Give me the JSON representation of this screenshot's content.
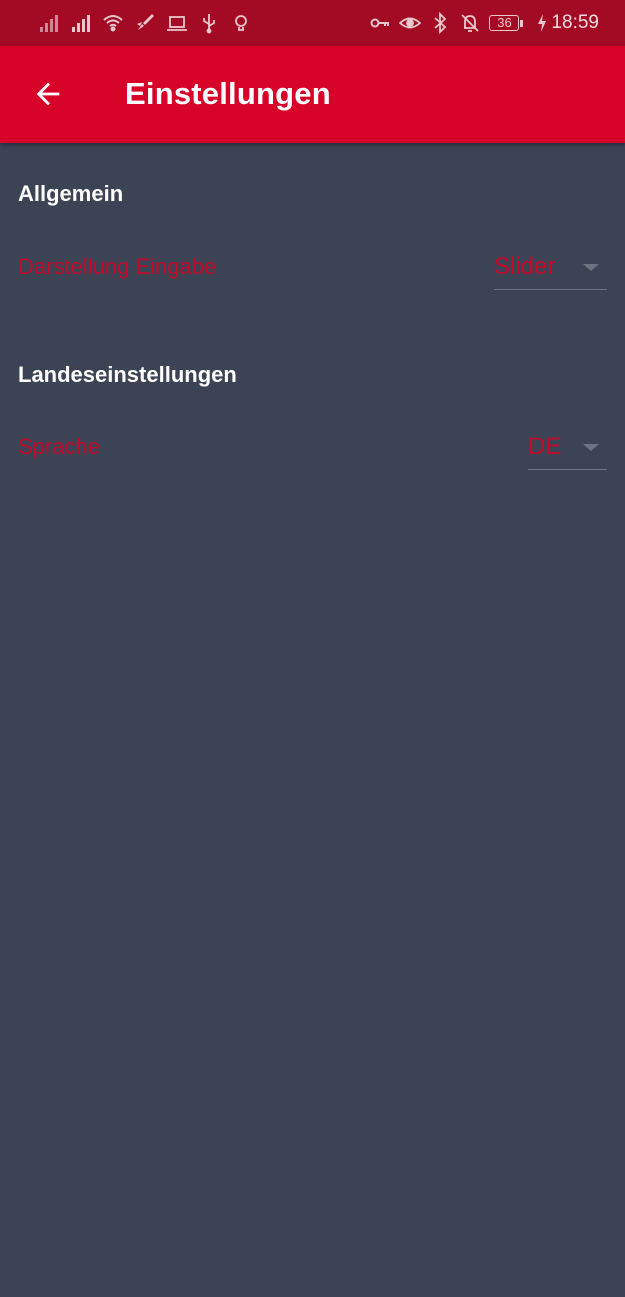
{
  "status_bar": {
    "time": "18:59",
    "battery_level": "36",
    "left_icons": [
      "signal-icon",
      "signal-icon",
      "wifi-icon",
      "rocket-icon",
      "laptop-icon",
      "usb-icon",
      "lightbulb-icon"
    ],
    "right_icons": [
      "key-icon",
      "eye-icon",
      "bluetooth-icon",
      "bell-off-icon",
      "battery-icon",
      "charging-icon"
    ]
  },
  "app_bar": {
    "title": "Einstellungen",
    "back_icon": "arrow-back-icon"
  },
  "sections": [
    {
      "title": "Allgemein",
      "preference": {
        "label": "Darstellung Eingabe",
        "value": "Slider"
      }
    },
    {
      "title": "Landeseinstellungen",
      "preference": {
        "label": "Sprache",
        "value": "DE"
      }
    }
  ],
  "colors": {
    "status_bar": "#a30b25",
    "app_bar": "#d80328",
    "background": "#3b4355",
    "accent_text": "#c30a2a",
    "section_title": "#ffffff"
  }
}
